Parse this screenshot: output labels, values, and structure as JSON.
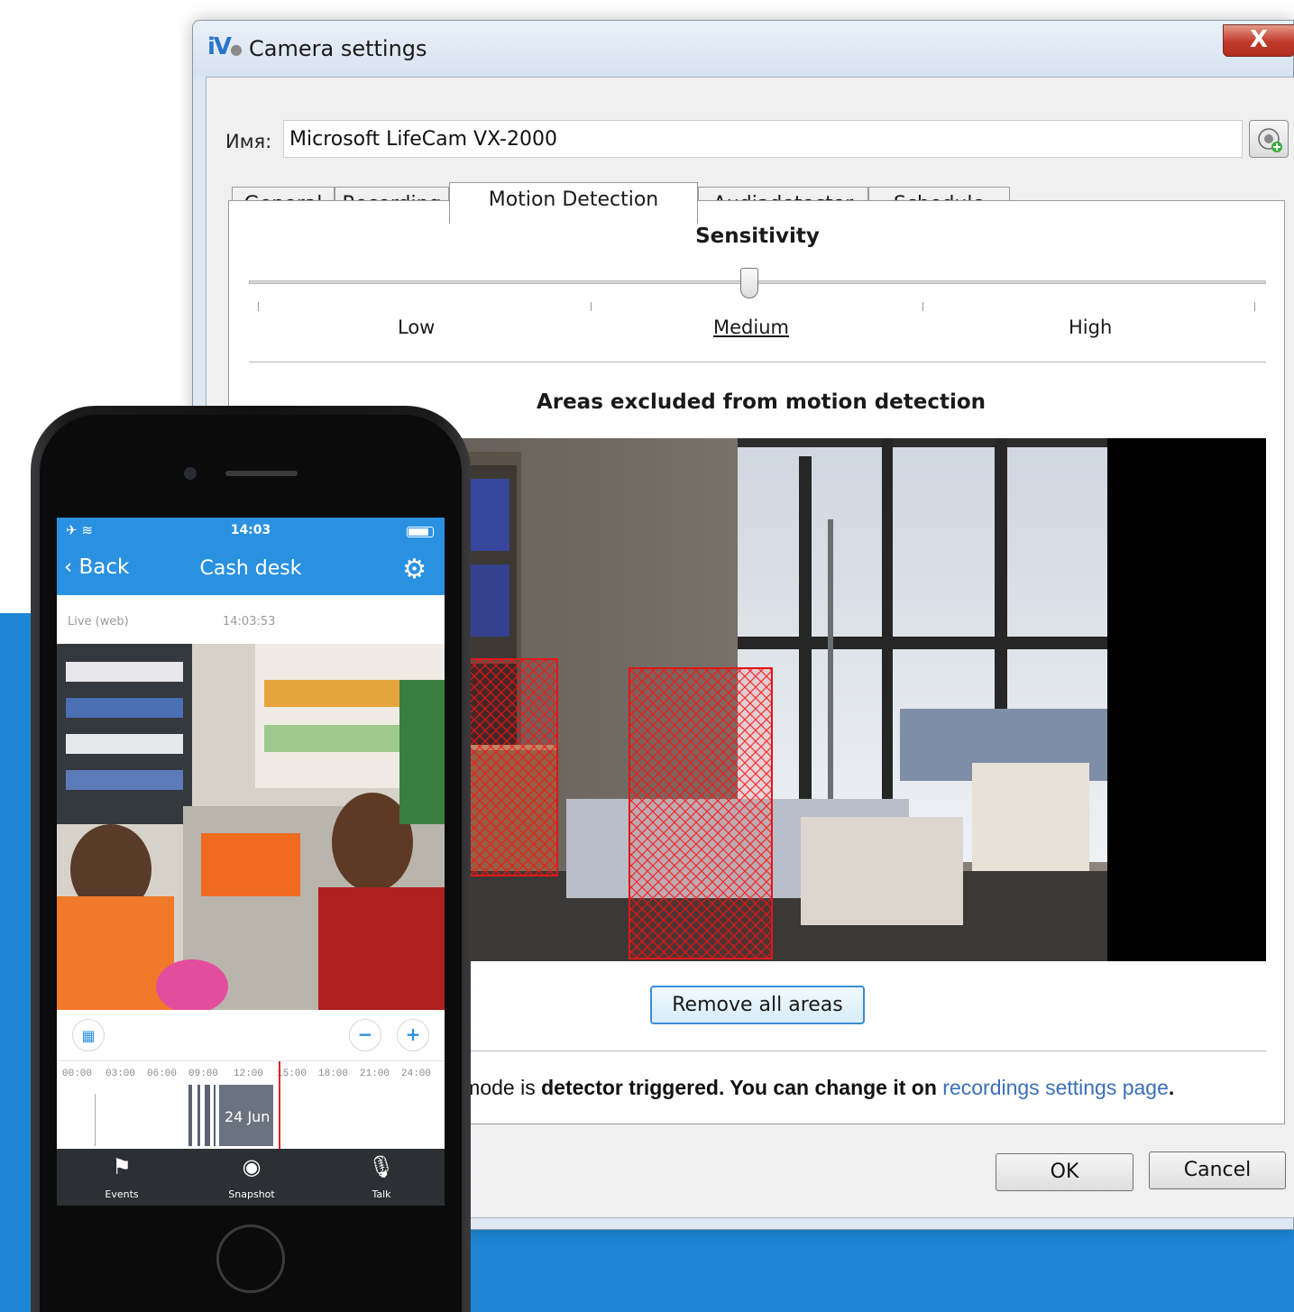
{
  "window": {
    "title": "Camera settings",
    "logo_text": "iV",
    "close_glyph": "X",
    "name_label": "Имя:",
    "name_value": "Microsoft LifeCam VX-2000",
    "tabs": [
      {
        "label": "General",
        "active": false
      },
      {
        "label": "Recording",
        "active": false
      },
      {
        "label": "Motion Detection",
        "active": true
      },
      {
        "label": "Audiadetector",
        "active": false
      },
      {
        "label": "Schedule",
        "active": false
      }
    ],
    "sensitivity": {
      "title": "Sensitivity",
      "labels": [
        "Low",
        "Medium",
        "High"
      ],
      "selected": "Medium"
    },
    "areas_title": "Areas excluded from motion detection",
    "remove_button": "Remove all areas",
    "notice": {
      "partial": "g mode is ",
      "bold1": "detector triggered",
      "middle": ". You can change it on ",
      "link": "recordings settings page",
      "end": "."
    },
    "ok_button": "OK",
    "cancel_button": "Cancel"
  },
  "phone": {
    "status_time": "14:03",
    "battery_level": 0.85,
    "back_label": "Back",
    "title": "Cash desk",
    "live_label": "Live (web)",
    "live_time": "14:03:53",
    "timeline_ticks": [
      "00:00",
      "03:00",
      "06:00",
      "09:00",
      "12:00",
      "15:00",
      "18:00",
      "21:00",
      "24:00"
    ],
    "timeline_date": "24 Jun",
    "tabbar": [
      {
        "label": "Events",
        "icon": "flag-icon"
      },
      {
        "label": "Snapshot",
        "icon": "camera-icon"
      },
      {
        "label": "Talk",
        "icon": "microphone-icon"
      }
    ]
  },
  "colors": {
    "accent_blue": "#1f86d6",
    "app_blue": "#2a91e0",
    "exclusion_red": "#e01818",
    "link_blue": "#3a6fb8"
  }
}
